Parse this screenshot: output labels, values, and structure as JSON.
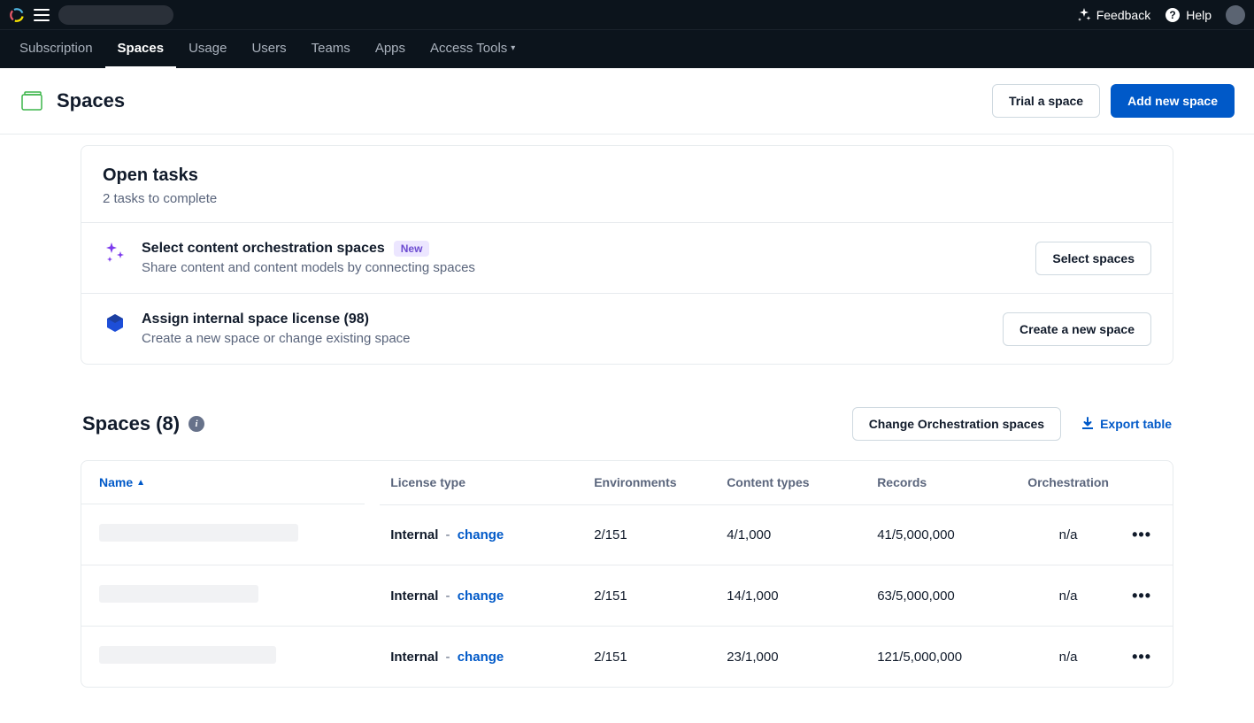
{
  "topbar": {
    "org_name": "",
    "feedback": "Feedback",
    "help": "Help"
  },
  "nav": {
    "items": [
      {
        "label": "Subscription",
        "active": false
      },
      {
        "label": "Spaces",
        "active": true
      },
      {
        "label": "Usage",
        "active": false
      },
      {
        "label": "Users",
        "active": false
      },
      {
        "label": "Teams",
        "active": false
      },
      {
        "label": "Apps",
        "active": false
      },
      {
        "label": "Access Tools",
        "active": false,
        "caret": true
      }
    ]
  },
  "page": {
    "title": "Spaces",
    "trial_btn": "Trial a space",
    "add_btn": "Add new space"
  },
  "open_tasks": {
    "title": "Open tasks",
    "subtitle": "2 tasks to complete",
    "tasks": [
      {
        "icon": "sparkle",
        "title": "Select content orchestration spaces",
        "badge": "New",
        "desc": "Share content and content models by connecting spaces",
        "action": "Select spaces"
      },
      {
        "icon": "hex",
        "title": "Assign internal space license (98)",
        "badge": null,
        "desc": "Create a new space or change existing space",
        "action": "Create a new space"
      }
    ]
  },
  "spaces_section": {
    "title": "Spaces (8)",
    "change_btn": "Change Orchestration spaces",
    "export_link": "Export table"
  },
  "table": {
    "columns": {
      "name": "Name",
      "license": "License type",
      "envs": "Environments",
      "ctypes": "Content types",
      "records": "Records",
      "orch": "Orchestration"
    },
    "change_label": "change",
    "rows": [
      {
        "name_redacted_w": 225,
        "license": "Internal",
        "envs": "2/151",
        "ctypes": "4/1,000",
        "records": "41/5,000,000",
        "orch": "n/a"
      },
      {
        "name_redacted_w": 180,
        "license": "Internal",
        "envs": "2/151",
        "ctypes": "14/1,000",
        "records": "63/5,000,000",
        "orch": "n/a"
      },
      {
        "name_redacted_w": 200,
        "license": "Internal",
        "envs": "2/151",
        "ctypes": "23/1,000",
        "records": "121/5,000,000",
        "orch": "n/a"
      }
    ]
  }
}
